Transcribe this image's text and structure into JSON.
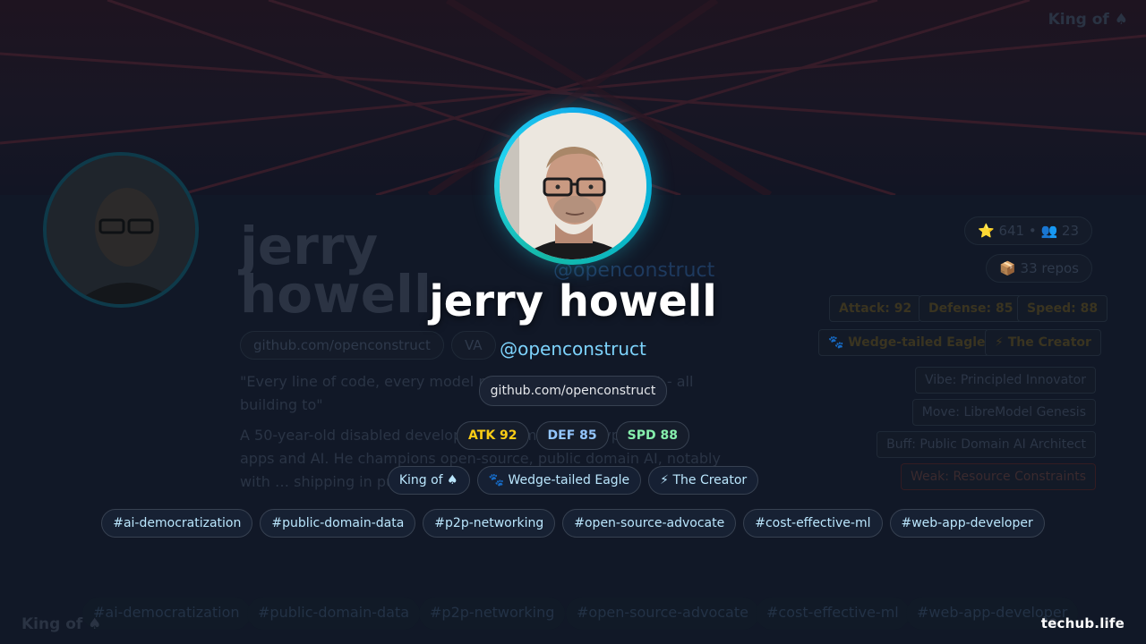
{
  "background": {
    "top_right_label": "King of ♠",
    "bottom_left_label": "King of ♠",
    "name_line1": "jerry",
    "name_line2": "howell",
    "handle": "@openconstruct",
    "link": "github.com/openconstruct",
    "location": "VA",
    "quote": "\"Every line of code, every model parameter, every dataset - all building to\"",
    "bio": "A 50-year-old disabled developer, … games and crypto to web apps and AI. He champions open-source, public domain AI, notably with … shipping in public.",
    "stars_line": "⭐ 641 • 👥 23",
    "repos_line": "📦 33 repos",
    "stats": [
      "Attack: 92",
      "Defense: 85",
      "Speed: 88"
    ],
    "badges": [
      "🐾 Wedge-tailed Eagle",
      "⚡ The Creator"
    ],
    "traits": [
      "Vibe: Principled Innovator",
      "Move: LibreModel Genesis",
      "Buff: Public Domain AI Architect",
      "Weak: Resource Constraints"
    ],
    "tags": [
      "#ai-democratization",
      "#public-domain-data",
      "#p2p-networking",
      "#open-source-advocate",
      "#cost-effective-ml",
      "#web-app-developer"
    ],
    "partial_brand": "te"
  },
  "card": {
    "name": "jerry howell",
    "handle": "@openconstruct",
    "link": "github.com/openconstruct",
    "stats": [
      {
        "label": "ATK 92",
        "color": "#facc15"
      },
      {
        "label": "DEF 85",
        "color": "#93c5fd"
      },
      {
        "label": "SPD 88",
        "color": "#86efac"
      }
    ],
    "badges": [
      "King of ♠",
      "🐾 Wedge-tailed Eagle",
      "⚡ The Creator"
    ],
    "tags": [
      "#ai-democratization",
      "#public-domain-data",
      "#p2p-networking",
      "#open-source-advocate",
      "#cost-effective-ml",
      "#web-app-developer"
    ]
  },
  "brand": "techub.life",
  "colors": {
    "accent_ring": "#22d3ee",
    "handle": "#7dd3fc",
    "background": "#0b1120"
  }
}
